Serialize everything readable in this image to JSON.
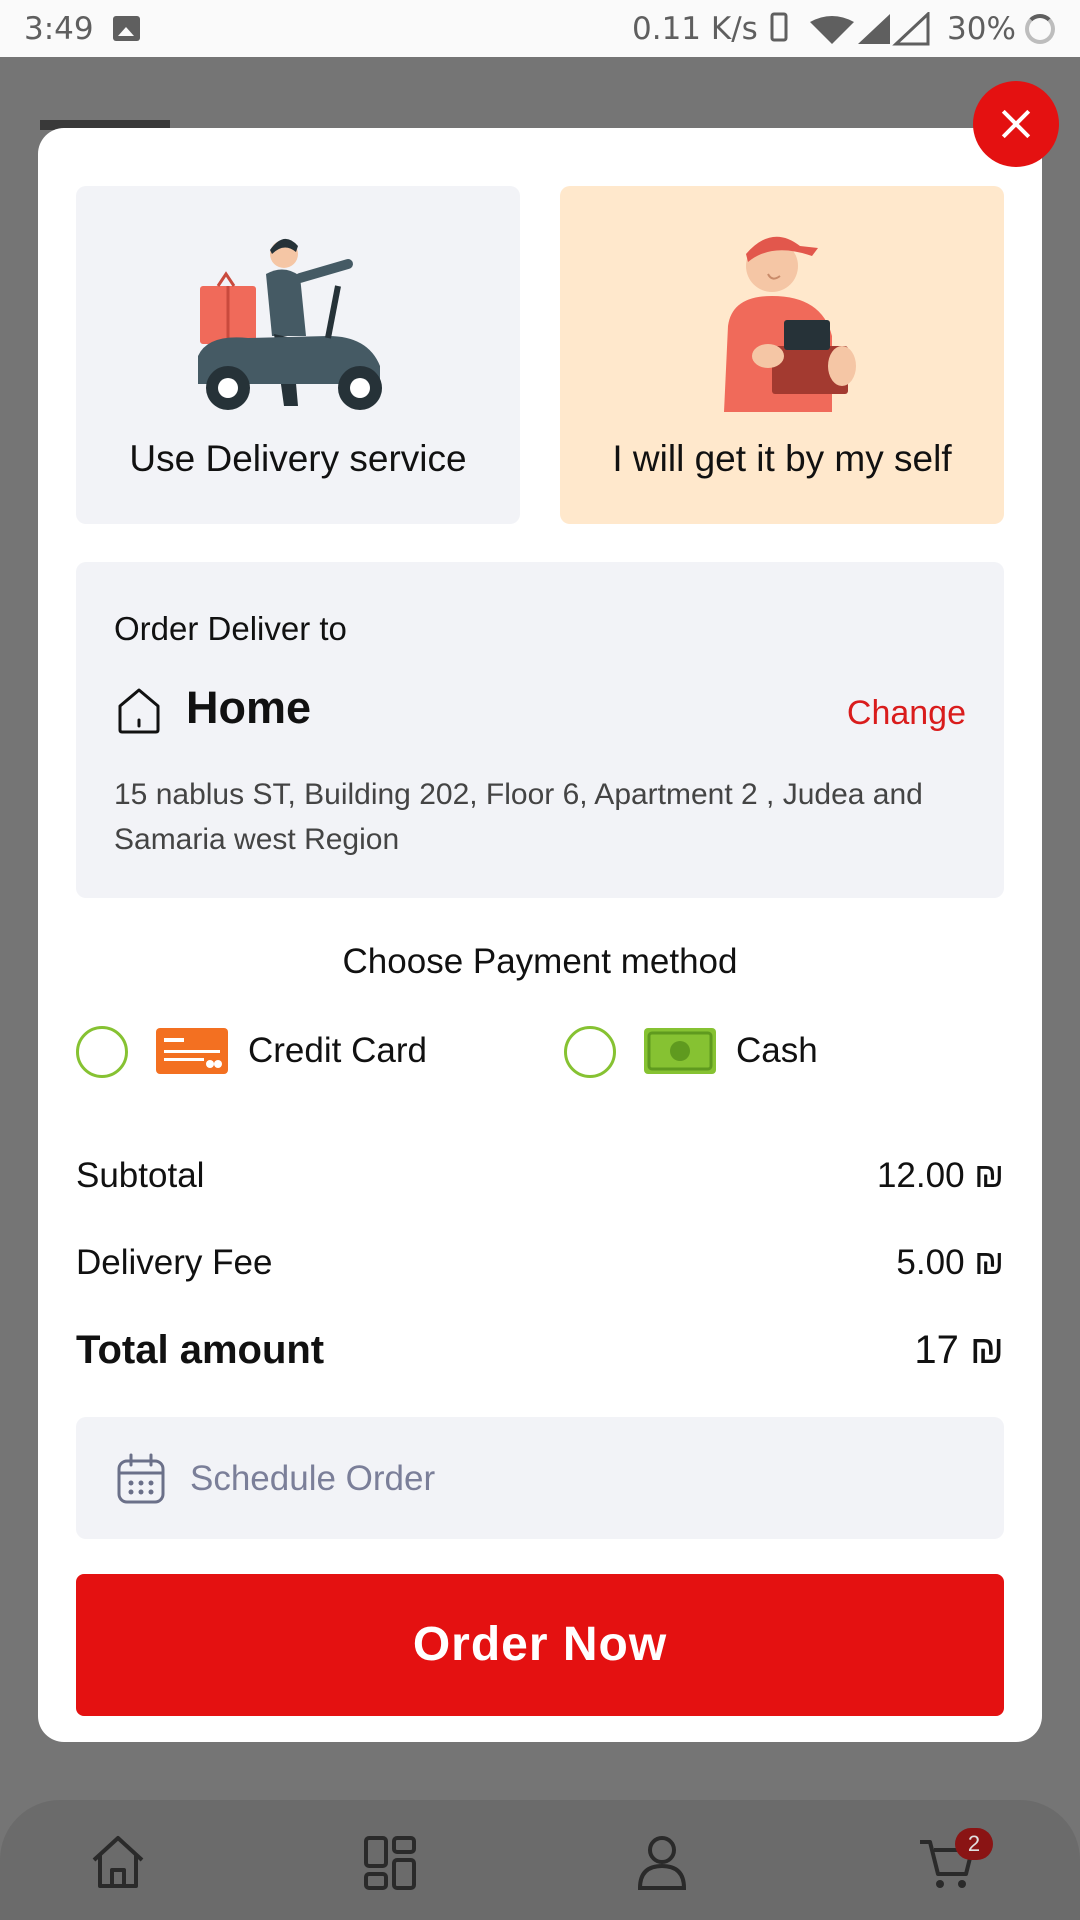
{
  "status_bar": {
    "time": "3:49",
    "speed": "0.11 K/s",
    "battery": "30%"
  },
  "delivery_options": [
    {
      "label": "Use Delivery service",
      "icon": "scooter-delivery-illustration",
      "selected": false
    },
    {
      "label": "I will get it by my self",
      "icon": "pickup-person-illustration",
      "selected": true
    }
  ],
  "address": {
    "heading": "Order Deliver to",
    "name": "Home",
    "change_label": "Change",
    "text": "15 nablus ST, Building 202, Floor 6, Apartment 2 , Judea and Samaria west Region"
  },
  "payment": {
    "title": "Choose Payment method",
    "methods": [
      {
        "label": "Credit Card",
        "icon": "credit-card-icon",
        "selected": false
      },
      {
        "label": "Cash",
        "icon": "cash-icon",
        "selected": false
      }
    ]
  },
  "summary": {
    "subtotal_label": "Subtotal",
    "subtotal_value": "12.00 ₪",
    "fee_label": "Delivery Fee",
    "fee_value": "5.00 ₪",
    "total_label": "Total amount",
    "total_value": "17 ₪"
  },
  "schedule": {
    "placeholder": "Schedule Order"
  },
  "order_button": "Order Now",
  "cart_badge": "2",
  "colors": {
    "accent_red": "#e41111",
    "radio_green": "#86c232",
    "selected_option_bg": "#ffe8cc",
    "card_bg": "#f2f3f7"
  }
}
